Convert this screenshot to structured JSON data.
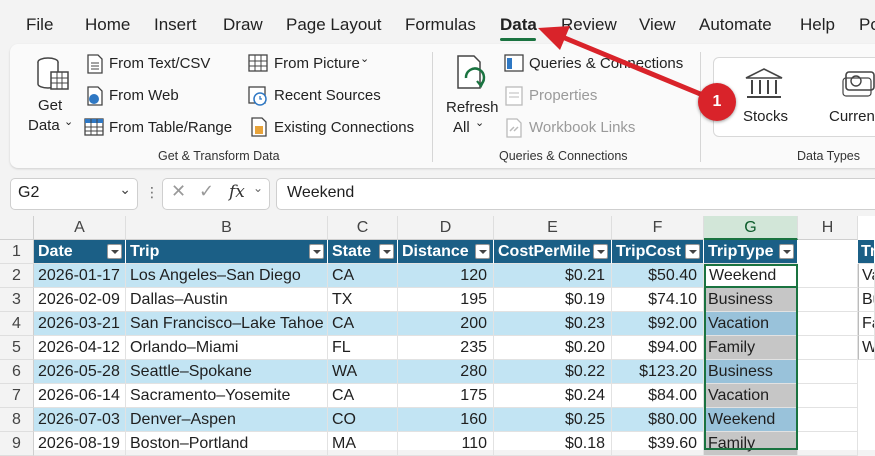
{
  "menu": {
    "tabs": [
      "File",
      "Home",
      "Insert",
      "Draw",
      "Page Layout",
      "Formulas",
      "Data",
      "Review",
      "View",
      "Automate",
      "Help",
      "Po"
    ],
    "active": "Data"
  },
  "ribbon": {
    "get_data": [
      "Get",
      "Data"
    ],
    "from_text_csv": "From Text/CSV",
    "from_web": "From Web",
    "from_table_range": "From Table/Range",
    "from_picture": "From Picture",
    "recent_sources": "Recent Sources",
    "existing_connections": "Existing Connections",
    "group_get_transform": "Get & Transform Data",
    "refresh_all": [
      "Refresh",
      "All"
    ],
    "queries_connections": "Queries & Connections",
    "properties": "Properties",
    "workbook_links": "Workbook Links",
    "group_queries": "Queries & Connections",
    "stocks": "Stocks",
    "currencies": "Currenc",
    "group_data_types": "Data Types"
  },
  "callout": {
    "number": "1"
  },
  "formula_bar": {
    "name_box": "G2",
    "fx": "fx",
    "value": "Weekend"
  },
  "sheet": {
    "columns": [
      "A",
      "B",
      "C",
      "D",
      "E",
      "F",
      "G",
      "H"
    ],
    "rows": [
      "1",
      "2",
      "3",
      "4",
      "5",
      "6",
      "7",
      "8",
      "9"
    ],
    "headers": [
      "Date",
      "Trip",
      "State",
      "Distance",
      "CostPerMile",
      "TripCost",
      "TripType"
    ],
    "data": [
      [
        "2026-01-17",
        "Los Angeles–San Diego",
        "CA",
        "120",
        "$0.21",
        "$50.40",
        "Weekend"
      ],
      [
        "2026-02-09",
        "Dallas–Austin",
        "TX",
        "195",
        "$0.19",
        "$74.10",
        "Business"
      ],
      [
        "2026-03-21",
        "San Francisco–Lake Tahoe",
        "CA",
        "200",
        "$0.23",
        "$92.00",
        "Vacation"
      ],
      [
        "2026-04-12",
        "Orlando–Miami",
        "FL",
        "235",
        "$0.20",
        "$94.00",
        "Family"
      ],
      [
        "2026-05-28",
        "Seattle–Spokane",
        "WA",
        "280",
        "$0.22",
        "$123.20",
        "Business"
      ],
      [
        "2026-06-14",
        "Sacramento–Yosemite",
        "CA",
        "175",
        "$0.24",
        "$84.00",
        "Vacation"
      ],
      [
        "2026-07-03",
        "Denver–Aspen",
        "CO",
        "160",
        "$0.25",
        "$80.00",
        "Weekend"
      ],
      [
        "2026-08-19",
        "Boston–Portland",
        "MA",
        "110",
        "$0.18",
        "$39.60",
        "Family"
      ]
    ],
    "side_table": {
      "header": "Tr",
      "items": [
        "Va",
        "Bu",
        "Fa",
        "W"
      ]
    }
  }
}
